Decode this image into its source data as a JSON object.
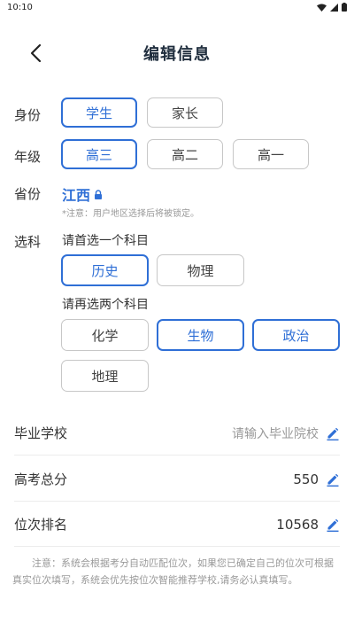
{
  "status_bar": {
    "time": "10:10"
  },
  "header": {
    "title": "编辑信息"
  },
  "identity": {
    "label": "身份",
    "options": [
      "学生",
      "家长"
    ],
    "selected": "学生"
  },
  "grade": {
    "label": "年级",
    "options": [
      "高三",
      "高二",
      "高一"
    ],
    "selected": "高三"
  },
  "province": {
    "label": "省份",
    "value": "江西",
    "note": "*注意：用户地区选择后将被锁定。"
  },
  "subjects": {
    "label": "选科",
    "first_prompt": "请首选一个科目",
    "first_options": [
      "历史",
      "物理"
    ],
    "first_selected": "历史",
    "second_prompt": "请再选两个科目",
    "second_options": [
      "化学",
      "生物",
      "政治",
      "地理"
    ],
    "second_selected": [
      "生物",
      "政治"
    ]
  },
  "school": {
    "label": "毕业学校",
    "placeholder": "请输入毕业院校"
  },
  "score": {
    "label": "高考总分",
    "value": "550"
  },
  "rank": {
    "label": "位次排名",
    "value": "10568"
  },
  "footer_note": "注意：系统会根据考分自动匹配位次，如果您已确定自己的位次可根据真实位次填写，系统会优先按位次智能推荐学校,请务必认真填写。",
  "colors": {
    "accent": "#2f6fd6",
    "border": "#c7c7c7",
    "muted": "#999999"
  }
}
